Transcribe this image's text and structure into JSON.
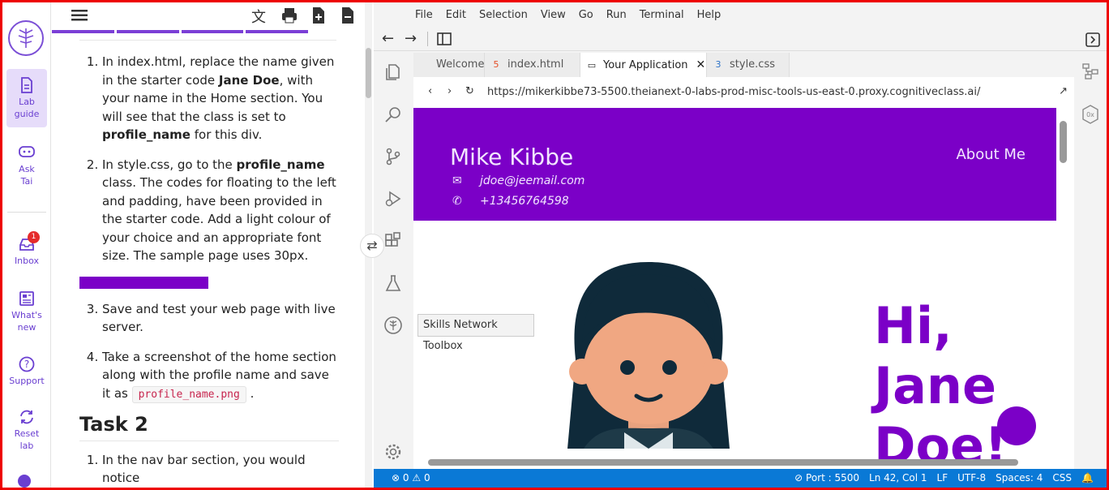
{
  "rail": {
    "items": [
      {
        "label_line1": "Lab",
        "label_line2": "guide",
        "icon": "document-icon"
      },
      {
        "label_line1": "Ask",
        "label_line2": "Tai",
        "icon": "chat-icon"
      },
      {
        "label_line1": "Inbox",
        "label_line2": "",
        "icon": "inbox-icon",
        "badge": "1"
      },
      {
        "label_line1": "What's",
        "label_line2": "new",
        "icon": "newspaper-icon"
      },
      {
        "label_line1": "Support",
        "label_line2": "",
        "icon": "help-icon"
      },
      {
        "label_line1": "Reset",
        "label_line2": "lab",
        "icon": "reset-icon"
      }
    ],
    "accent": "#6a3fd1"
  },
  "guide": {
    "step1_a": "In index.html, replace the name given in the starter code ",
    "step1_b": "Jane Doe",
    "step1_c": ", with your name in the Home section. You will see that the class is set to ",
    "step1_d": "profile_name",
    "step1_e": " for this div.",
    "step2_a": "In style.css, go to the ",
    "step2_b": "profile_name",
    "step2_c": " class. The codes for floating to the left and padding, have been provided in the starter code. Add a light colour of your choice and an appropriate font size. The sample page uses 30px.",
    "step3": "Save and test your web page with live server.",
    "step4_a": "Take a screenshot of the home section along with the profile name and save it as ",
    "step4_code": "profile_name.png",
    "step4_b": " .",
    "task_heading": "Task 2",
    "next_line": "In the nav bar section, you would notice"
  },
  "ide": {
    "menu": [
      "File",
      "Edit",
      "Selection",
      "View",
      "Go",
      "Run",
      "Terminal",
      "Help"
    ],
    "tabs": [
      {
        "label": "Welcome",
        "icon": ""
      },
      {
        "label": "index.html",
        "icon": "html-icon"
      },
      {
        "label": "Your Application",
        "icon": "browser-icon",
        "active": true
      },
      {
        "label": "style.css",
        "icon": "css-icon"
      }
    ],
    "url": "https://mikerkibbe73-5500.theianext-0-labs-prod-misc-tools-us-east-0.proxy.cognitiveclass.ai/",
    "tooltip": "Skills Network Toolbox"
  },
  "app": {
    "name": "Mike Kibbe",
    "email": "jdoe@jeemail.com",
    "phone": "+13456764598",
    "nav_about": "About Me",
    "hi_line1": "Hi,",
    "hi_line2": "Jane",
    "hi_line3": "Doe!",
    "brand_color": "#7b00c7"
  },
  "status": {
    "problems_errors": "0",
    "problems_warnings": "0",
    "port": "Port : 5500",
    "position": "Ln 42, Col 1",
    "eol": "LF",
    "encoding": "UTF-8",
    "spaces": "Spaces: 4",
    "language": "CSS"
  }
}
